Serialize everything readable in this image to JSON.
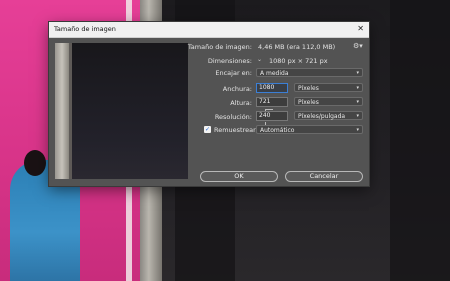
{
  "dialog": {
    "title": "Tamaño de imagen",
    "close_icon": "close-icon",
    "image_size_label": "Tamaño de imagen:",
    "image_size_value": "4,46 MB (era 112,0 MB)",
    "dimensions_label": "Dimensiones:",
    "dimensions_value": "1080 px × 721 px",
    "fit_to_label": "Encajar en:",
    "fit_to_value": "A medida",
    "width_label": "Anchura:",
    "width_value": "1080",
    "width_unit": "Píxeles",
    "height_label": "Altura:",
    "height_value": "721",
    "height_unit": "Píxeles",
    "resolution_label": "Resolución:",
    "resolution_value": "240",
    "resolution_unit": "Píxeles/pulgada",
    "resample_label": "Remuestrear:",
    "resample_checked": true,
    "resample_value": "Automático",
    "ok_label": "OK",
    "cancel_label": "Cancelar"
  },
  "colors": {
    "dialog_bg": "#535353",
    "focus_border": "#3b7fd6"
  }
}
